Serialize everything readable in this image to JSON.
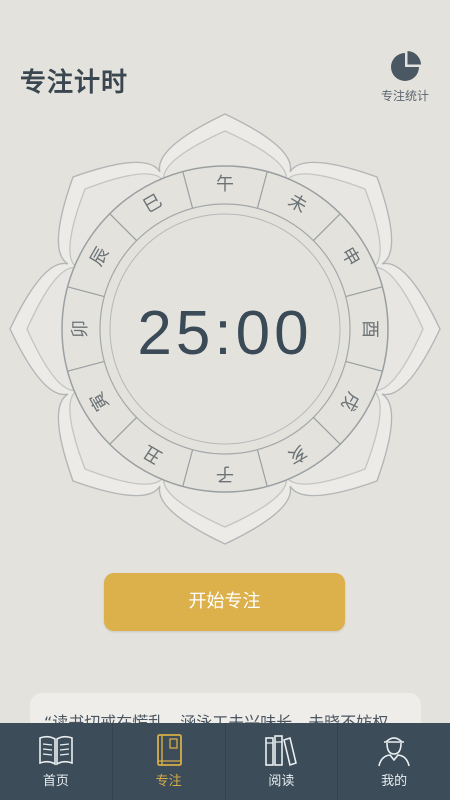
{
  "header": {
    "title": "专注计时",
    "stats_label": "专注统计"
  },
  "timer": {
    "display": "25:00"
  },
  "dial": {
    "branches": [
      "子",
      "丑",
      "寅",
      "卯",
      "辰",
      "巳",
      "午",
      "未",
      "申",
      "酉",
      "戌",
      "亥"
    ]
  },
  "actions": {
    "start_label": "开始专注"
  },
  "quote": {
    "text": "“读书切戒在慌乱，涵泳工夫兴味长。未晓不妨权"
  },
  "tabbar": {
    "active_index": 1,
    "items": [
      {
        "label": "首页",
        "icon": "open-book-icon"
      },
      {
        "label": "专注",
        "icon": "closed-book-icon"
      },
      {
        "label": "阅读",
        "icon": "bookshelf-icon"
      },
      {
        "label": "我的",
        "icon": "scholar-avatar-icon"
      }
    ]
  },
  "colors": {
    "background": "#e4e2dd",
    "accent": "#dcb04b",
    "tabbar": "#3c4c58",
    "active_tab": "#d8ad47",
    "text": "#3a4750"
  }
}
